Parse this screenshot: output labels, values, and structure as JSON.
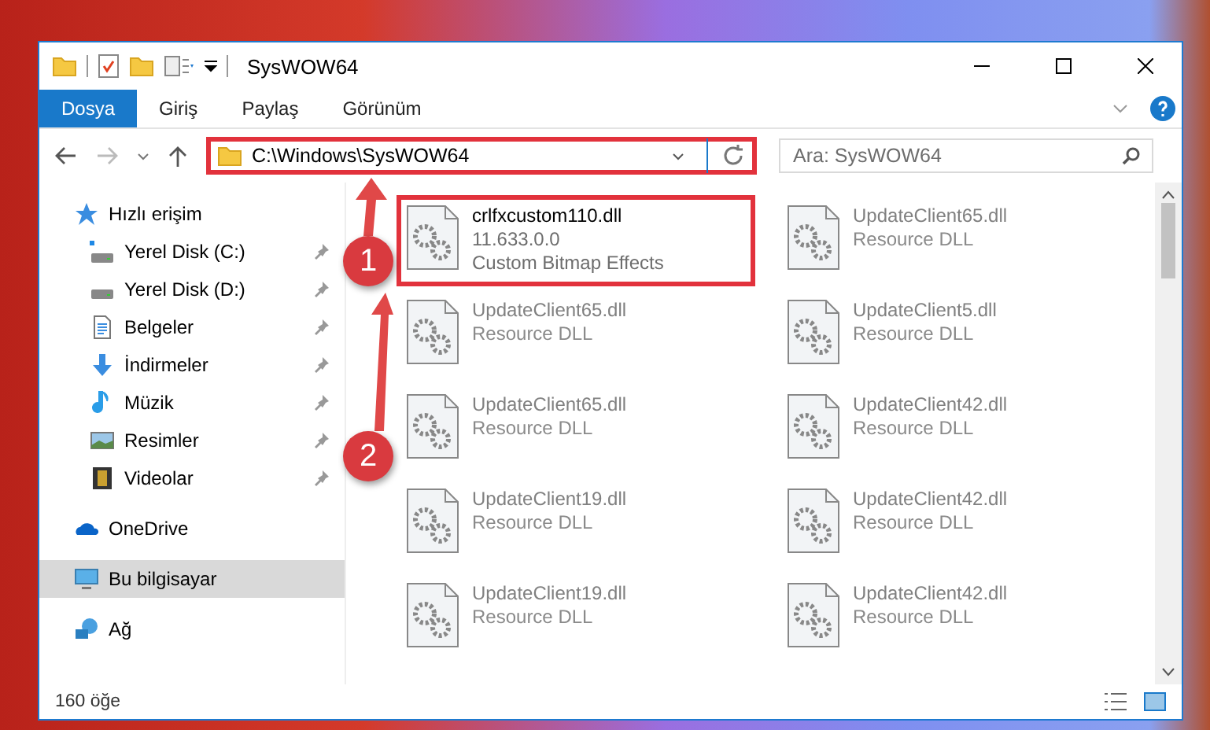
{
  "window": {
    "title": "SysWOW64"
  },
  "ribbon_tabs": [
    {
      "label": "Dosya",
      "selected": true
    },
    {
      "label": "Giriş",
      "selected": false
    },
    {
      "label": "Paylaş",
      "selected": false
    },
    {
      "label": "Görünüm",
      "selected": false
    }
  ],
  "address_bar": {
    "path": "C:\\Windows\\SysWOW64",
    "highlighted": true
  },
  "search": {
    "placeholder": "Ara: SysWOW64"
  },
  "nav": [
    {
      "label": "Hızlı erişim",
      "kind": "quick",
      "selected": false,
      "children": [
        {
          "label": "Yerel Disk (C:)",
          "kind": "system-drive",
          "pinned": true
        },
        {
          "label": "Yerel Disk (D:)",
          "kind": "drive",
          "pinned": true
        },
        {
          "label": "Belgeler",
          "kind": "documents",
          "pinned": true
        },
        {
          "label": "İndirmeler",
          "kind": "downloads",
          "pinned": true
        },
        {
          "label": "Müzik",
          "kind": "music",
          "pinned": true
        },
        {
          "label": "Resimler",
          "kind": "pictures",
          "pinned": true
        },
        {
          "label": "Videolar",
          "kind": "videos",
          "pinned": true
        }
      ]
    },
    {
      "label": "OneDrive",
      "kind": "cloud",
      "selected": false
    },
    {
      "label": "Bu bilgisayar",
      "kind": "computer",
      "selected": true
    },
    {
      "label": "Ağ",
      "kind": "network",
      "selected": false
    }
  ],
  "files": [
    {
      "name": "crlfxcustom110.dll",
      "version": "11.633.0.0",
      "description": "Custom Bitmap Effects",
      "blurred": false,
      "highlighted": true
    },
    {
      "name": "UpdateClient65.dll",
      "description": "Resource DLL",
      "blurred": true,
      "highlighted": false
    },
    {
      "name": "UpdateClient65.dll",
      "description": "Resource DLL",
      "blurred": true,
      "highlighted": false
    },
    {
      "name": "UpdateClient5.dll",
      "description": "Resource DLL",
      "blurred": true,
      "highlighted": false
    },
    {
      "name": "UpdateClient65.dll",
      "description": "Resource DLL",
      "blurred": true,
      "highlighted": false
    },
    {
      "name": "UpdateClient42.dll",
      "description": "Resource DLL",
      "blurred": true,
      "highlighted": false
    },
    {
      "name": "UpdateClient19.dll",
      "description": "Resource DLL",
      "blurred": true,
      "highlighted": false
    },
    {
      "name": "UpdateClient42.dll",
      "description": "Resource DLL",
      "blurred": true,
      "highlighted": false
    },
    {
      "name": "UpdateClient19.dll",
      "description": "Resource DLL",
      "blurred": true,
      "highlighted": false
    },
    {
      "name": "UpdateClient42.dll",
      "description": "Resource DLL",
      "blurred": true,
      "highlighted": false
    }
  ],
  "status_bar": {
    "item_count": "160 öğe"
  },
  "annotations": [
    {
      "label": "1"
    },
    {
      "label": "2"
    }
  ]
}
